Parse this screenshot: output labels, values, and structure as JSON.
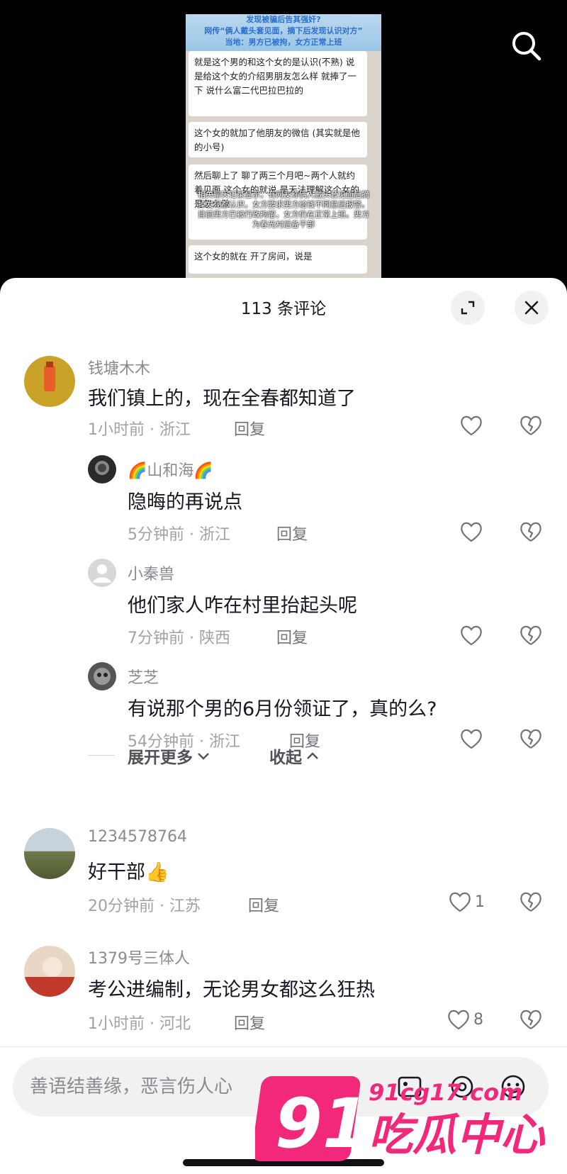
{
  "video": {
    "banner_lines": [
      "发现被骗后告其强奸?",
      "网传“俩人戴头套见面，摘下后发现认识对方”",
      "当地：男方已被拘，女方正常上班"
    ],
    "bubbles": [
      "就是这个男的和这个女的是认识(不熟) 说是给这个女的介绍男朋友怎么样 就捧了一下 说什么富二代巴拉巴拉的",
      "这个女的就加了他朋友的微信 (其实就是他的小号)",
      "然后聊上了 聊了两三个月吧~两个人就约着见面 这个女的就说 是无法理解这个女的是怎么做",
      "这个女的就在 开了房间，说是"
    ],
    "overlay_caption": "相关聊天记录显示，有网友称俩人戴头套见面后摘掉发现都认识，女方要求男方给钱不同意后报警。目前男方已被行政拘留，女方仍在正常上班。男方为春光村后备干部"
  },
  "sheet": {
    "title": "113 条评论"
  },
  "comments": [
    {
      "name": "钱塘木木",
      "text": "我们镇上的，现在全春都知道了",
      "time": "1小时前 · 浙江",
      "reply": "回复",
      "likes": ""
    },
    {
      "name": "🌈山和海🌈",
      "text": "隐晦的再说点",
      "time": "5分钟前 · 浙江",
      "reply": "回复",
      "likes": ""
    },
    {
      "name": "小秦兽",
      "text": "他们家人咋在村里抬起头呢",
      "time": "7分钟前 · 陕西",
      "reply": "回复",
      "likes": ""
    },
    {
      "name": "芝芝",
      "text": "有说那个男的6月份领证了，真的么?",
      "time": "54分钟前 · 浙江",
      "reply": "回复",
      "likes": ""
    },
    {
      "name": "1234578764",
      "text": "好干部👍",
      "time": "20分钟前 · 江苏",
      "reply": "回复",
      "likes": "1"
    },
    {
      "name": "1379号三体人",
      "text": "考公进编制，无论男女都这么狂热",
      "time": "1小时前 · 河北",
      "reply": "回复",
      "likes": "8"
    }
  ],
  "expand": {
    "more": "展开更多",
    "collapse": "收起"
  },
  "input": {
    "placeholder": "善语结善缘，恶言伤人心"
  },
  "watermark": {
    "number": "91",
    "domain": "91cg17.com",
    "text": "吃瓜中心"
  },
  "colors": {
    "watermark_pink": "#f2287a",
    "text_primary": "#161823",
    "text_secondary": "#8a8b91"
  }
}
